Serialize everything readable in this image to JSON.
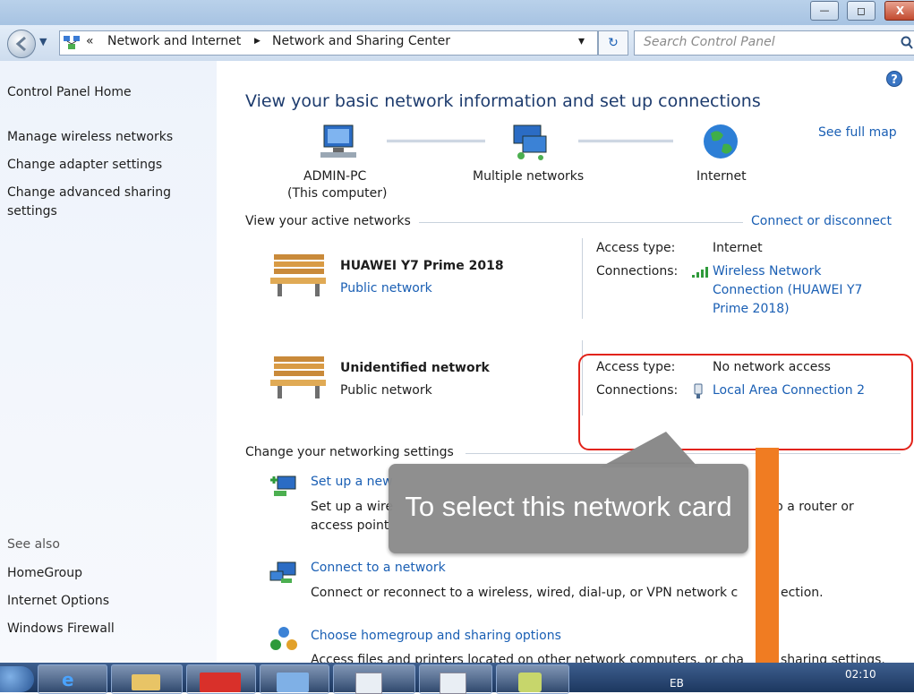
{
  "window": {
    "minimize_glyph": "—",
    "maximize_glyph": "◻",
    "close_glyph": "X"
  },
  "address": {
    "chevron": "«",
    "crumb_1": "Network and Internet",
    "separator": "▶",
    "crumb_2": "Network and Sharing Center",
    "dropdown_glyph": "▾",
    "search_placeholder": "Search Control Panel"
  },
  "sidebar": {
    "home": "Control Panel Home",
    "links": [
      "Manage wireless networks",
      "Change adapter settings",
      "Change advanced sharing",
      "settings"
    ],
    "see_also": "See also",
    "see_also_links": [
      "HomeGroup",
      "Internet Options",
      "Windows Firewall"
    ]
  },
  "main": {
    "title": "View your basic network information and set up connections",
    "see_full_map": "See full map",
    "map": {
      "computer_line1": "ADMIN-PC",
      "computer_line2": "(This computer)",
      "networks": "Multiple networks",
      "internet": "Internet"
    },
    "active_header": "View your active networks",
    "connect_disconnect": "Connect or disconnect",
    "networks": [
      {
        "name": "HUAWEI Y7 Prime 2018",
        "category": "Public network",
        "access_label": "Access type:",
        "access_value": "Internet",
        "conn_label": "Connections:",
        "conn_lines": [
          "Wireless Network",
          "Connection (HUAWEI Y7",
          "Prime 2018)"
        ]
      },
      {
        "name": "Unidentified network",
        "category": "Public network",
        "access_label": "Access type:",
        "access_value": "No network access",
        "conn_label": "Connections:",
        "conn_lines": [
          "Local Area Connection 2"
        ]
      }
    ],
    "change_header": "Change your networking settings",
    "tasks": [
      {
        "link": "Set up a new",
        "desc_a": "Set up a wire",
        "desc_b": "access point",
        "desc_right": "up a router or"
      },
      {
        "link": "Connect to a network",
        "desc_a": "Connect or reconnect to a wireless, wired, dial-up, or VPN network c",
        "desc_right": "ection."
      },
      {
        "link": "Choose homegroup and sharing options",
        "desc_a": "Access files and printers located on other network computers, or cha",
        "desc_right": "sharing settings."
      }
    ]
  },
  "callout": {
    "text": "To select this network card"
  },
  "taskbar": {
    "lang": "EB",
    "clock": "02:10"
  },
  "colors": {
    "link": "#1a5fb4",
    "highlight": "#e2231a",
    "arrow": "#f07c22",
    "callout": "#8b8b8b"
  }
}
